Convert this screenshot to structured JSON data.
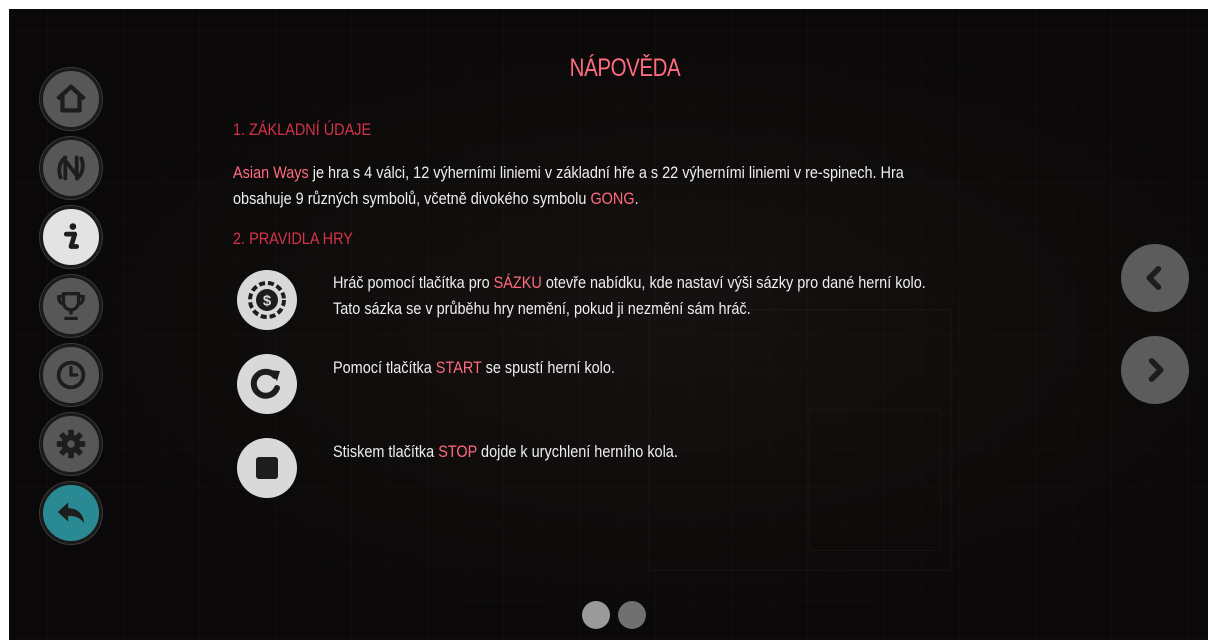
{
  "page": {
    "title": "NÁPOVĚDA",
    "section1": {
      "heading": "1. ZÁKLADNÍ ÚDAJE",
      "game_name": "Asian Ways",
      "text_a": " je hra s 4 válci, 12 výherními liniemi v základní hře a s 22 výherními liniemi v re-spinech. Hra",
      "text_b": "obsahuje 9 různých symbolů, včetně divokého symbolu ",
      "wild_symbol": "GONG",
      "text_c": "."
    },
    "section2": {
      "heading": "2. PRAVIDLA HRY",
      "rules": [
        {
          "icon": "coin-bet-icon",
          "pre": "Hráč pomocí tlačítka pro ",
          "keyword": "SÁZKU",
          "post": " otevře nabídku, kde nastaví výši sázky pro dané herní kolo.",
          "line2": "Tato sázka se v průběhu hry nemění, pokud ji nezmění sám hráč."
        },
        {
          "icon": "start-spin-icon",
          "pre": "Pomocí tlačítka ",
          "keyword": "START",
          "post": " se spustí herní kolo."
        },
        {
          "icon": "stop-icon",
          "pre": "Stiskem tlačítka ",
          "keyword": "STOP",
          "post": " dojde k urychlení herního kola."
        }
      ]
    }
  },
  "left_nav": [
    {
      "name": "home-icon"
    },
    {
      "name": "paytable-icon"
    },
    {
      "name": "info-icon"
    },
    {
      "name": "trophy-icon"
    },
    {
      "name": "history-clock-icon"
    },
    {
      "name": "settings-gear-icon"
    },
    {
      "name": "back-arrow-icon",
      "active": true
    }
  ],
  "pagination": {
    "pages": 2,
    "current": 1
  },
  "colors": {
    "background": "#0c0909",
    "title": "#ff6b7f",
    "heading": "#d6324a",
    "highlight": "#ff6b7f",
    "text": "#eeeeee",
    "nav_button": "#575757",
    "nav_active": "#2a8a93",
    "rule_icon": "#d9d9d9"
  }
}
